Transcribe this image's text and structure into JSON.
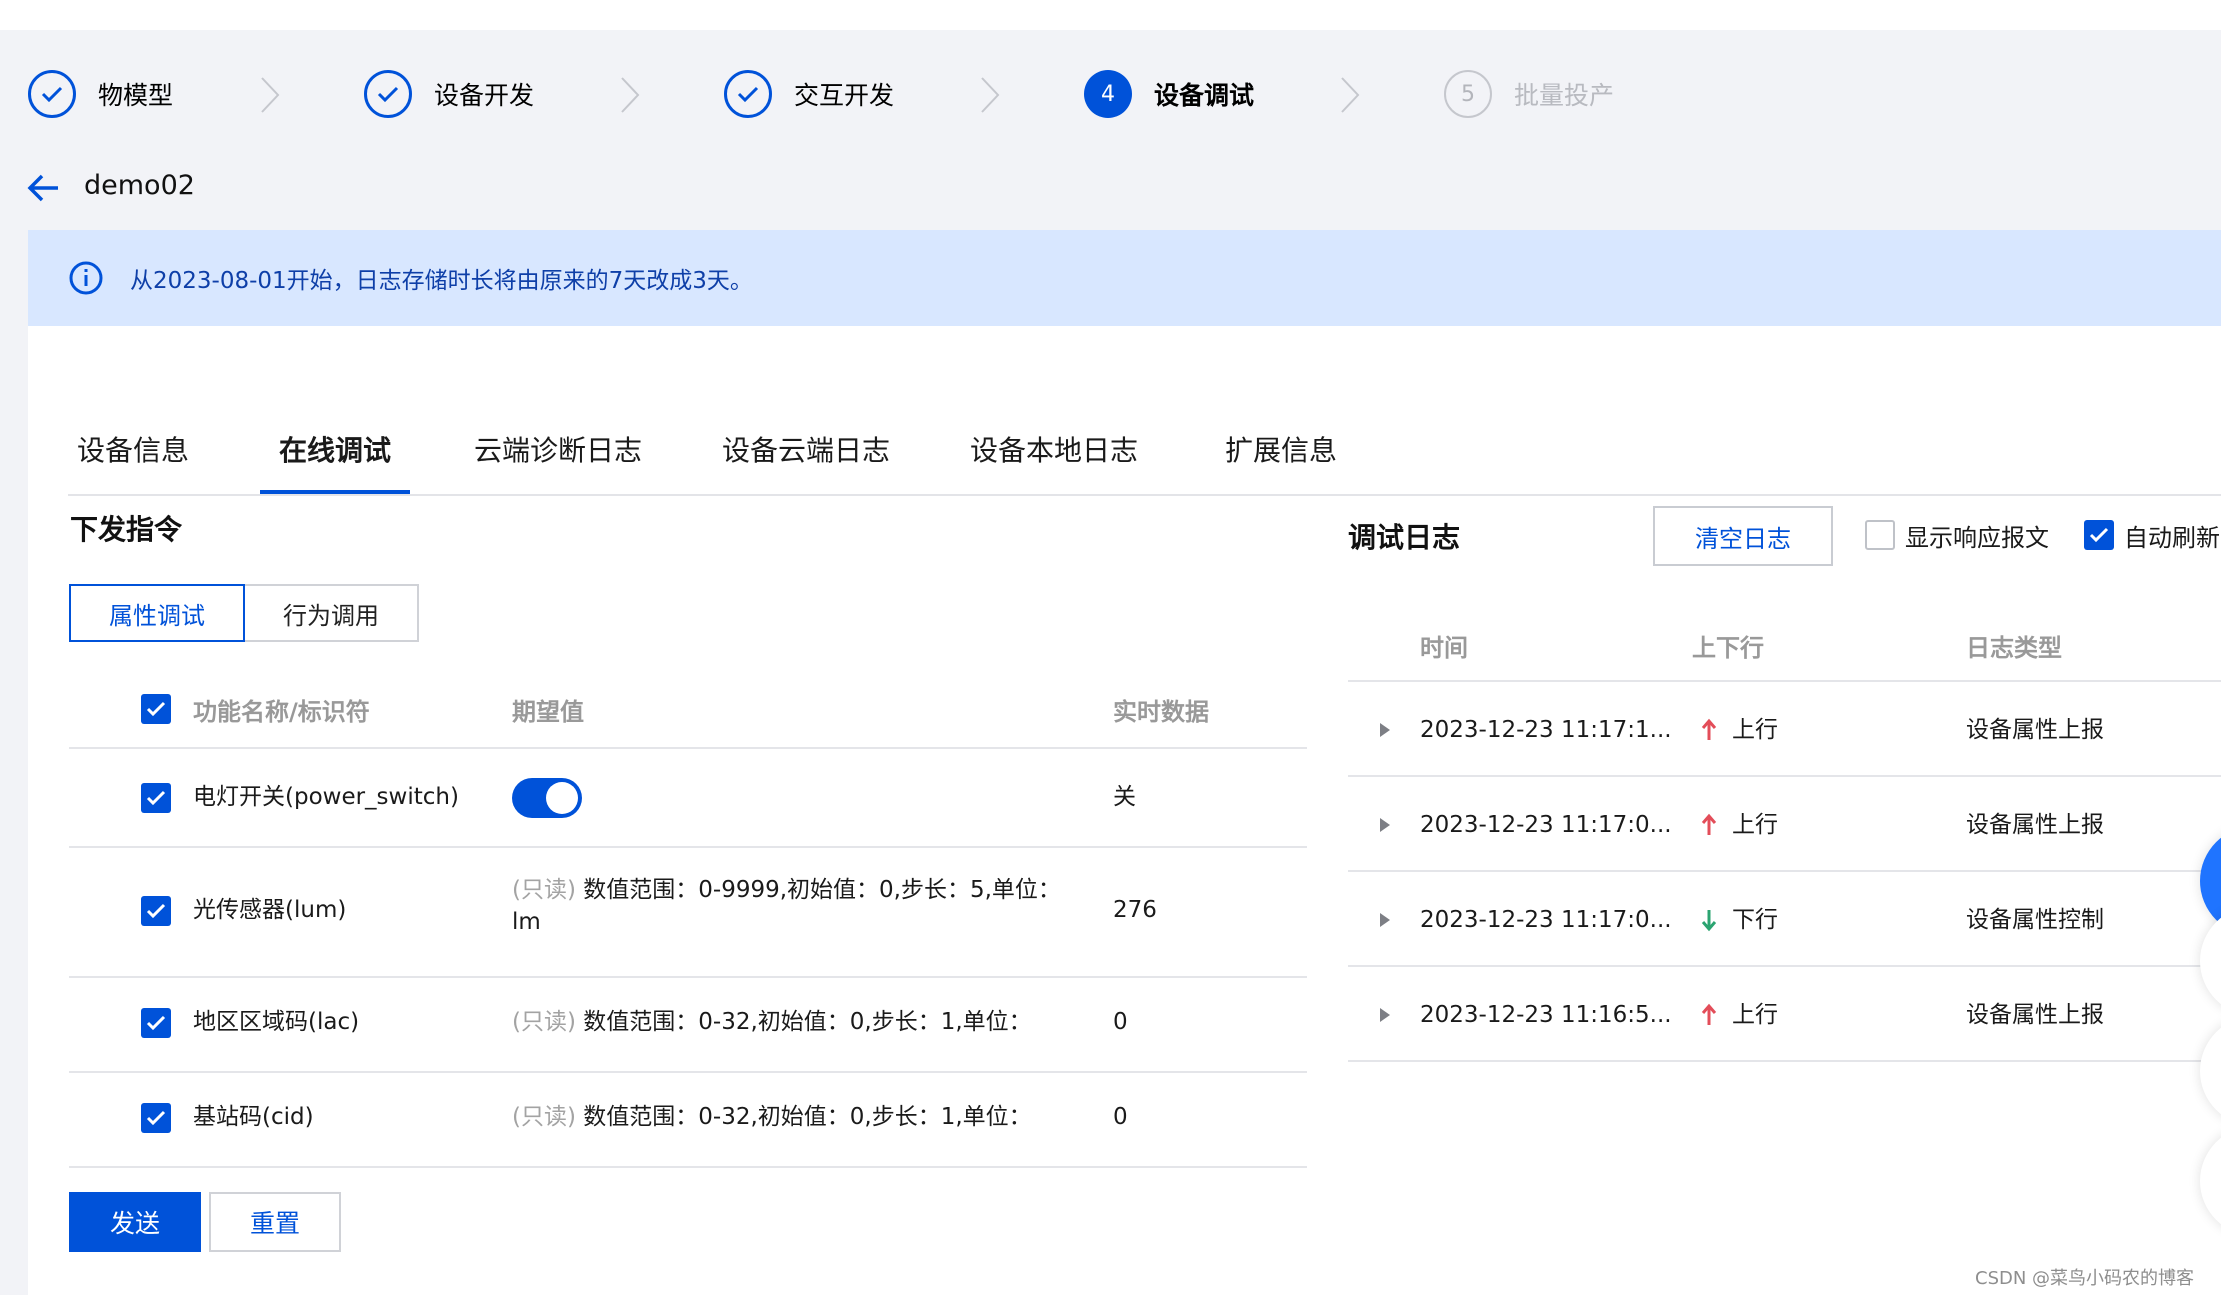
{
  "stepper": {
    "steps": [
      {
        "label": "物模型",
        "state": "done",
        "icon": "check-icon"
      },
      {
        "label": "设备开发",
        "state": "done",
        "icon": "check-icon"
      },
      {
        "label": "交互开发",
        "state": "done",
        "icon": "check-icon"
      },
      {
        "label": "设备调试",
        "state": "active",
        "number": "4"
      },
      {
        "label": "批量投产",
        "state": "todo",
        "number": "5"
      }
    ]
  },
  "header": {
    "device_name": "demo02"
  },
  "notice": {
    "text": "从2023-08-01开始，日志存储时长将由原来的7天改成3天。"
  },
  "tabs": [
    "设备信息",
    "在线调试",
    "云端诊断日志",
    "设备云端日志",
    "设备本地日志",
    "扩展信息"
  ],
  "left": {
    "title": "下发指令",
    "segments": [
      "属性调试",
      "行为调用"
    ],
    "columns": [
      "功能名称/标识符",
      "期望值",
      "实时数据"
    ],
    "rows": [
      {
        "name": "电灯开关(power_switch)",
        "expected_readonly": "",
        "expected": "",
        "realtime": "关",
        "toggle_on": true
      },
      {
        "name": "光传感器(lum)",
        "expected_readonly": "(只读)",
        "expected": " 数值范围：0-9999,初始值：0,步长：5,单位：",
        "expected_line2": "lm",
        "realtime": "276"
      },
      {
        "name": "地区区域码(lac)",
        "expected_readonly": "(只读)",
        "expected": " 数值范围：0-32,初始值：0,步长：1,单位：",
        "realtime": "0"
      },
      {
        "name": "基站码(cid)",
        "expected_readonly": "(只读)",
        "expected": " 数值范围：0-32,初始值：0,步长：1,单位：",
        "realtime": "0"
      }
    ],
    "send_label": "发送",
    "reset_label": "重置"
  },
  "right": {
    "title": "调试日志",
    "clear_label": "清空日志",
    "show_response_label": "显示响应报文",
    "show_response_checked": false,
    "auto_refresh_label": "自动刷新",
    "auto_refresh_checked": true,
    "columns": [
      "时间",
      "上下行",
      "日志类型"
    ],
    "rows": [
      {
        "time": "2023-12-23 11:17:1...",
        "direction": "上行",
        "dir_icon": "arrow-up-icon",
        "dir_color": "#e34d59",
        "type": "设备属性上报"
      },
      {
        "time": "2023-12-23 11:17:0...",
        "direction": "上行",
        "dir_icon": "arrow-up-icon",
        "dir_color": "#e34d59",
        "type": "设备属性上报"
      },
      {
        "time": "2023-12-23 11:17:0...",
        "direction": "下行",
        "dir_icon": "arrow-down-icon",
        "dir_color": "#2ba471",
        "type": "设备属性控制"
      },
      {
        "time": "2023-12-23 11:16:5...",
        "direction": "上行",
        "dir_icon": "arrow-up-icon",
        "dir_color": "#e34d59",
        "type": "设备属性上报"
      }
    ]
  },
  "watermark": "CSDN @菜鸟小码农的博客",
  "colors": {
    "accent": "#0052d9",
    "notice_bg": "#d8e7ff",
    "up": "#e34d59",
    "down": "#2ba471"
  }
}
